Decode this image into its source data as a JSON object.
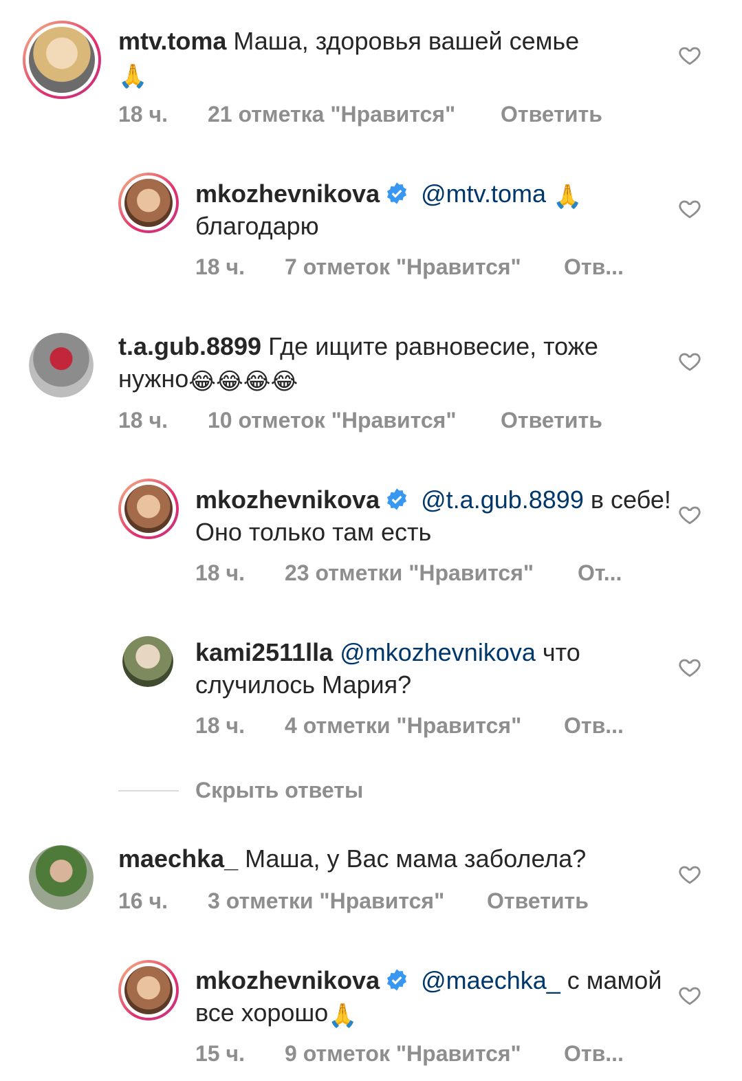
{
  "comments": [
    {
      "username": "mtv.toma",
      "verified": false,
      "mention": "",
      "text": "Маша, здоровья вашей семье",
      "emoji": "🙏",
      "time": "18 ч.",
      "likes": "21 отметка \"Нравится\"",
      "reply": "Ответить"
    },
    {
      "username": "mkozhevnikova",
      "verified": true,
      "mention": "@mtv.toma",
      "text": "благодарю",
      "emoji": "🙏",
      "time": "18 ч.",
      "likes": "7 отметок \"Нравится\"",
      "reply": "Отв..."
    },
    {
      "username": "t.a.gub.8899",
      "verified": false,
      "mention": "",
      "text": "Где ищите равновесие, тоже нужно",
      "emoji": "😂😂😂😂",
      "time": "18 ч.",
      "likes": "10 отметок \"Нравится\"",
      "reply": "Ответить"
    },
    {
      "username": "mkozhevnikova",
      "verified": true,
      "mention": "@t.a.gub.8899",
      "text": "в себе! Оно только там есть",
      "emoji": "",
      "time": "18 ч.",
      "likes": "23 отметки \"Нравится\"",
      "reply": "От..."
    },
    {
      "username": "kami2511lla",
      "verified": false,
      "mention": "@mkozhevnikova",
      "text": "что случилось Мария?",
      "emoji": "",
      "time": "18 ч.",
      "likes": "4 отметки \"Нравится\"",
      "reply": "Отв..."
    },
    {
      "username": "maechka_",
      "verified": false,
      "mention": "",
      "text": "Маша, у Вас мама заболела?",
      "emoji": "",
      "time": "16 ч.",
      "likes": "3 отметки \"Нравится\"",
      "reply": "Ответить"
    },
    {
      "username": "mkozhevnikova",
      "verified": true,
      "mention": "@maechka_",
      "text": "с мамой все хорошо",
      "emoji": "🙏",
      "time": "15 ч.",
      "likes": "9 отметок \"Нравится\"",
      "reply": "Отв..."
    }
  ],
  "hide_replies": "Скрыть ответы",
  "colors": {
    "username": "#262626",
    "mention": "#00376b",
    "meta": "#8e8e8e",
    "verified": "#3897f0"
  }
}
